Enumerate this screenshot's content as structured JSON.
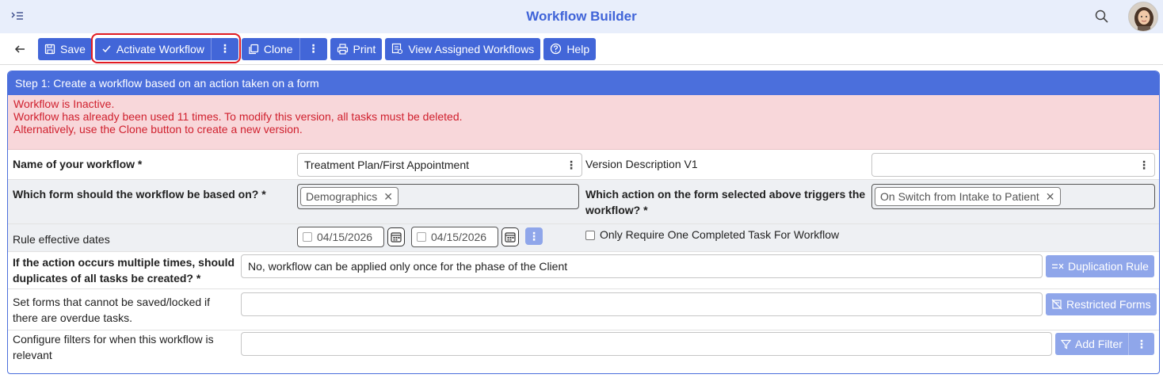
{
  "header": {
    "title": "Workflow Builder"
  },
  "toolbar": {
    "save": "Save",
    "activate": "Activate Workflow",
    "kebab": "⋮",
    "clone": "Clone",
    "print": "Print",
    "view_assigned": "View Assigned Workflows",
    "help": "Help"
  },
  "panel": {
    "title": "Step 1: Create a workflow based on an action taken on a form",
    "alert": [
      "Workflow is Inactive.",
      "Workflow has already been used 11 times. To modify this version, all tasks must be deleted.",
      "Alternatively, use the Clone button to create a new version."
    ]
  },
  "form": {
    "name_label": "Name of your workflow *",
    "name_value": "Treatment Plan/First Appointment",
    "version_label": "Version Description V1",
    "version_value": "",
    "form_label": "Which form should the workflow be based on? *",
    "form_chip": "Demographics",
    "action_label_1": "Which action on the form selected above triggers the",
    "action_label_2": "workflow? *",
    "action_chip": "On Switch from Intake to Patient",
    "dates_label": "Rule effective dates",
    "date_start": "04/15/2026",
    "date_end": "04/15/2026",
    "one_task_label": "Only Require One Completed Task For Workflow",
    "dup_label_1": "If the action occurs multiple times, should",
    "dup_label_2": "duplicates of all tasks be created? *",
    "dup_value": "No, workflow can be applied only once for the phase of the Client",
    "dup_button": "Duplication Rule",
    "restrict_label_1": "Set forms that cannot be saved/locked if",
    "restrict_label_2": "there are overdue tasks.",
    "restrict_button": "Restricted Forms",
    "filter_label_1": "Configure filters for when this workflow is",
    "filter_label_2": "relevant",
    "filter_button": "Add Filter"
  },
  "colors": {
    "primary": "#4266d8",
    "title": "#3f63d8",
    "alert_bg": "#f8d7da",
    "alert_text": "#d0202e",
    "highlight": "#e11b22",
    "muted_btn": "#8fa6ea"
  },
  "icons": [
    "menu-collapse-icon",
    "search-icon",
    "avatar",
    "back-arrow-icon",
    "save-icon",
    "check-icon",
    "clone-icon",
    "print-icon",
    "view-list-icon",
    "help-icon",
    "calendar-icon",
    "duplication-icon",
    "restricted-forms-icon",
    "filter-icon"
  ]
}
